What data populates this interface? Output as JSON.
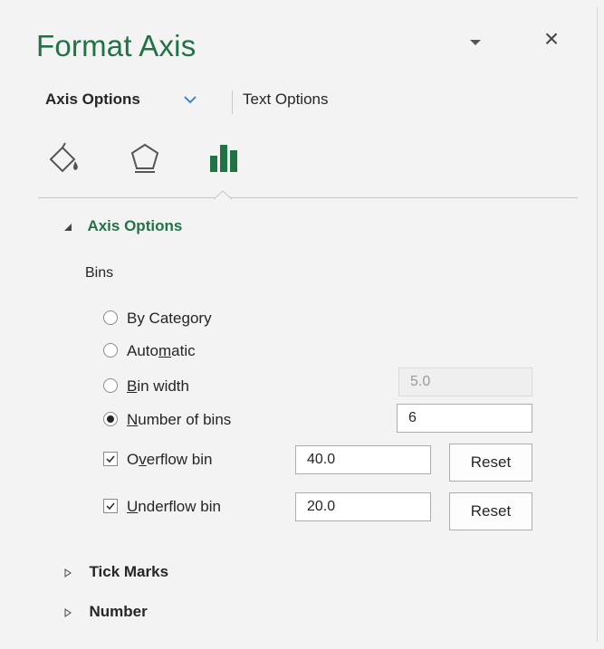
{
  "header": {
    "title": "Format Axis"
  },
  "tabs": {
    "axis_options": "Axis Options",
    "text_options": "Text Options"
  },
  "icons": [
    "fill-line-icon",
    "effects-pentagon-icon",
    "axis-options-bars-icon"
  ],
  "section": {
    "title": "Axis Options",
    "bins_label": "Bins"
  },
  "options": {
    "by_category": {
      "pre": "By Cate",
      "u": "g",
      "post": "ory"
    },
    "automatic": {
      "pre": "Auto",
      "u": "m",
      "post": "atic"
    },
    "bin_width": {
      "pre": "",
      "u": "B",
      "post": "in width",
      "value": "5.0"
    },
    "number_of_bins": {
      "pre": "",
      "u": "N",
      "post": "umber of bins",
      "value": "6"
    },
    "overflow_bin": {
      "pre": "O",
      "u": "v",
      "post": "erflow bin",
      "value": "40.0",
      "checked": true,
      "reset_label": "Reset"
    },
    "underflow_bin": {
      "pre": "",
      "u": "U",
      "post": "nderflow bin",
      "value": "20.0",
      "checked": true,
      "reset_label": "Reset"
    }
  },
  "collapsed_sections": {
    "tick_marks": "Tick Marks",
    "number": "Number"
  },
  "colors": {
    "accent": "#217346",
    "chevron": "#2b7cd3"
  }
}
